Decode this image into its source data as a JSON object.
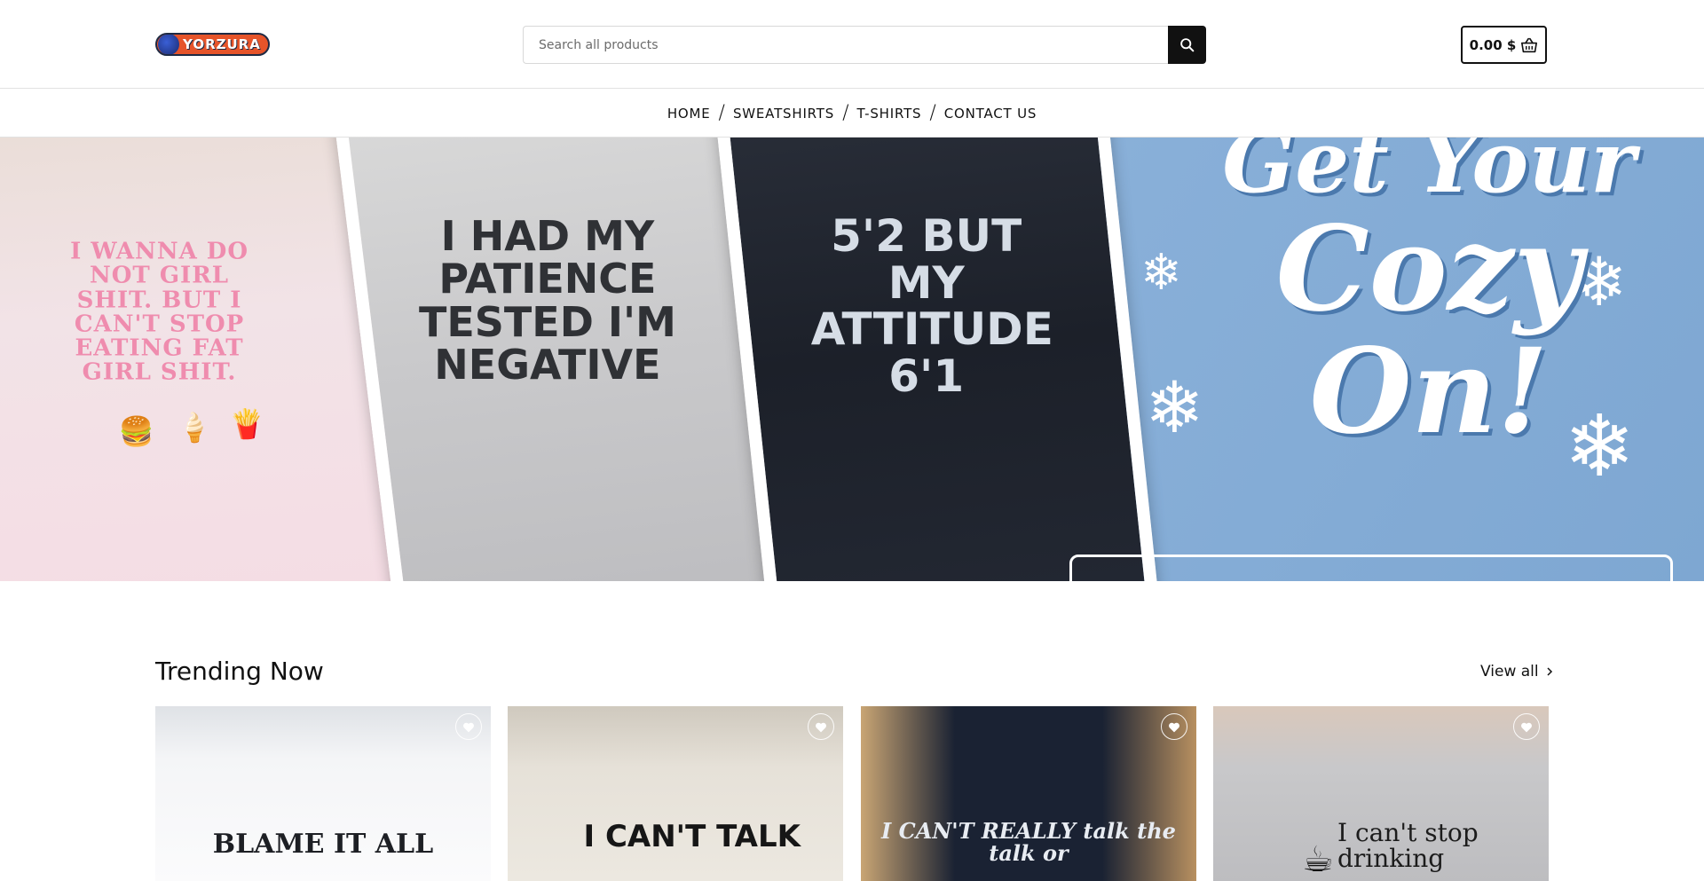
{
  "header": {
    "logo_text": "YORZURA",
    "search_placeholder": "Search all products",
    "cart_total": "0.00 $"
  },
  "nav": {
    "items": [
      {
        "label": "HOME"
      },
      {
        "label": "SWEATSHIRTS"
      },
      {
        "label": "T-SHIRTS"
      },
      {
        "label": "CONTACT US"
      }
    ],
    "separator": "/"
  },
  "hero": {
    "shirt_1": "I WANNA DO NOT GIRL SHIT. BUT I CAN'T STOP EATING FAT GIRL SHIT.",
    "shirt_2": "I HAD MY PATIENCE TESTED I'M NEGATIVE",
    "shirt_3": "5'2 BUT MY ATTITUDE 6'1",
    "headline_line1": "Get Your",
    "headline_line2": "Cozy",
    "headline_line3": "On!"
  },
  "trending": {
    "title": "Trending Now",
    "view_all": "View all",
    "products": [
      {
        "print": "BLAME IT ALL",
        "bg": "#eef0f2"
      },
      {
        "print": "I CAN'T TALK",
        "bg": "#e8e4dc"
      },
      {
        "print": "I CAN'T REALLY talk the talk or",
        "bg": "#1a2233"
      },
      {
        "print": "I can't stop drinking",
        "bg": "#cfcfd1"
      }
    ]
  },
  "colors": {
    "hero_blue": "#88afd8",
    "logo_orange": "#e6542a",
    "text": "#111111"
  }
}
